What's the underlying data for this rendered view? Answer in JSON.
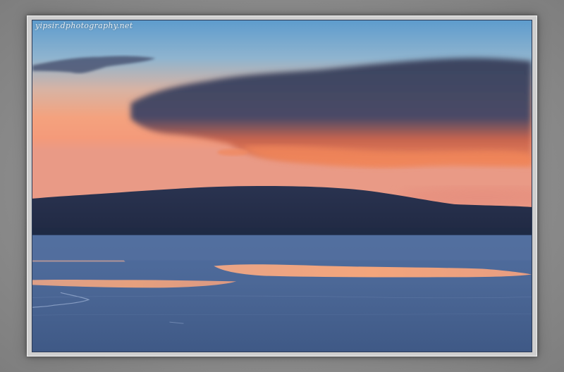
{
  "photo": {
    "watermark": "yipsir.dphotography.net",
    "subject": "sunset-over-frozen-lake-with-hill"
  },
  "colors": {
    "frame_gray": "#8c8c8c",
    "sky_top": "#6aa3cf",
    "sky_glow": "#f7a07a",
    "cloud_dark": "#3b4560",
    "cloud_glow": "#f07a55",
    "hill": "#26304a",
    "ice": "#4e6a9c",
    "reflection": "#f0a27c"
  }
}
